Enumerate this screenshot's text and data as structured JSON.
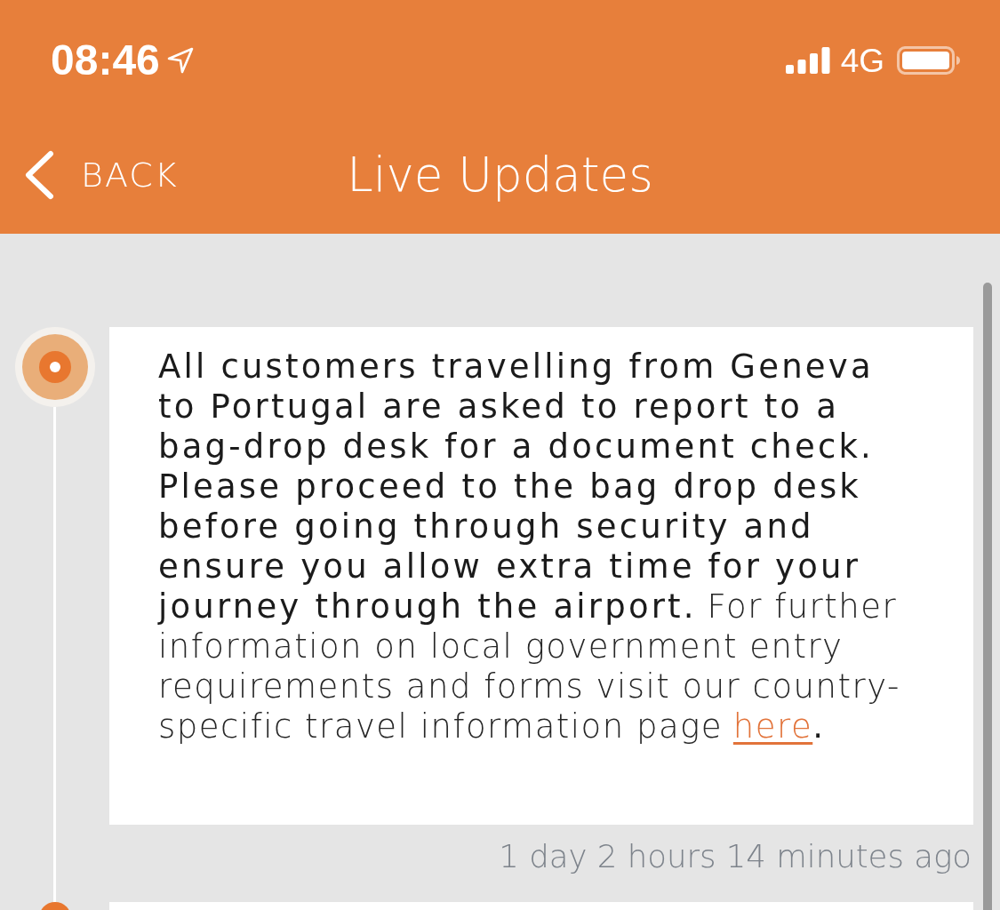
{
  "status_bar": {
    "time": "08:46",
    "network": "4G"
  },
  "nav_bar": {
    "back": "BACK",
    "title": "Live Updates"
  },
  "updates": [
    {
      "kind": "full",
      "message": "All customers travelling from Geneva to Portugal are asked to report to a bag-drop desk for a document check. Please proceed to the bag drop desk before going through security and ensure you allow extra time for your journey through the airport.",
      "info": "For further information on local government entry requirements and forms visit our country-specific travel information page",
      "link": "here",
      "after_link": ".",
      "time": "1 day 2 hours 14 minutes ago"
    },
    {
      "kind": "partial"
    }
  ]
}
